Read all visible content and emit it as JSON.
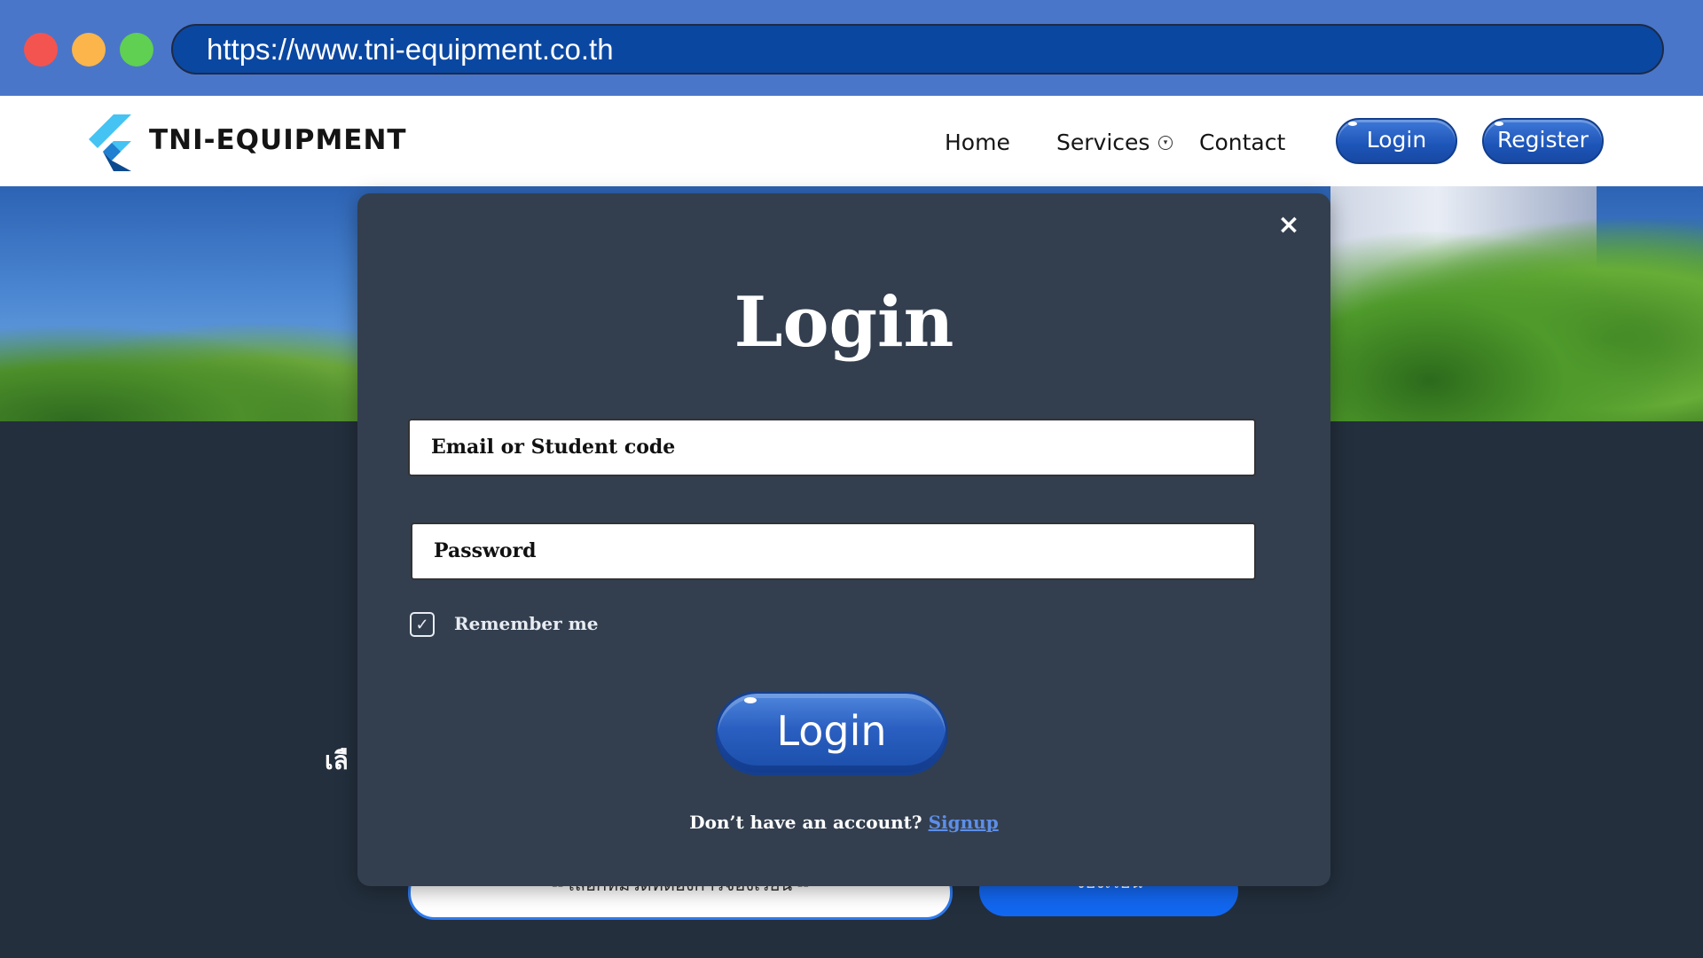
{
  "browser": {
    "url": "https://www.tni-equipment.co.th"
  },
  "nav": {
    "brand": "TNI-EQUIPMENT",
    "home": "Home",
    "services": "Services",
    "contact": "Contact",
    "login": "Login",
    "register": "Register"
  },
  "background": {
    "thai_label": "เลื",
    "select_text": "-- เลือกหมวดที่ต้องการจองเรียน --",
    "button_text": "จองเรียน"
  },
  "modal": {
    "close": "×",
    "title": "Login",
    "email_placeholder": "Email or Student code",
    "password_placeholder": "Password",
    "remember_label": "Remember me",
    "remember_checked": true,
    "submit": "Login",
    "signup_prompt": "Don’t have an account?",
    "signup_link": "Signup"
  },
  "colors": {
    "chrome": "#4a76c9",
    "urlbar": "#0a47a1",
    "modal_bg": "#333f4f",
    "accent": "#1d55b8"
  },
  "icons": {
    "window_controls": [
      "close-dot",
      "minimize-dot",
      "maximize-dot"
    ],
    "logo": "flutter-logo-icon",
    "services_dropdown": "chevron-down-circle-icon",
    "remember_checkbox": "checkmark-icon",
    "close": "close-icon"
  }
}
